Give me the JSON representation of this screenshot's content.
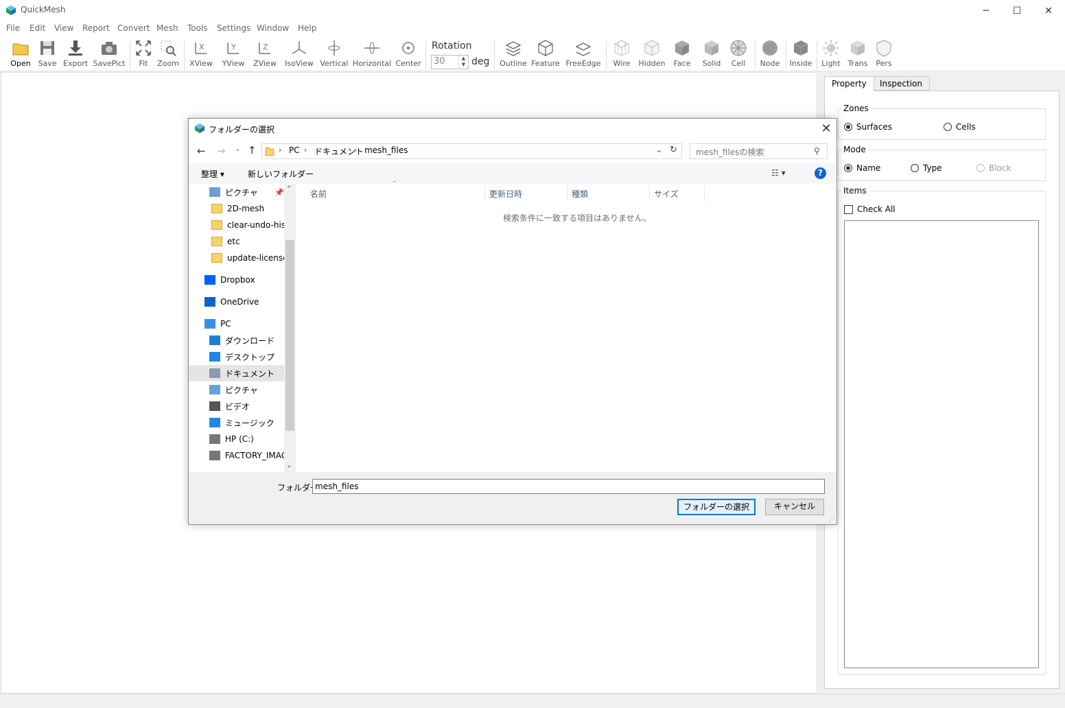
{
  "app": {
    "title": "QuickMesh",
    "accent": "#0078d7"
  },
  "window_controls": {
    "minimize": "─",
    "maximize": "☐",
    "close": "✕"
  },
  "menu": [
    "File",
    "Edit",
    "View",
    "Report",
    "Convert",
    "Mesh",
    "Tools",
    "Settings",
    "Window",
    "Help"
  ],
  "toolbar": {
    "open": "Open",
    "save": "Save",
    "export": "Export",
    "savepict": "SavePict",
    "fit": "Fit",
    "zoom": "Zoom",
    "xview": "XView",
    "yview": "YView",
    "zview": "ZView",
    "isoview": "IsoView",
    "vertical": "Vertical",
    "horizontal": "Horizontal",
    "center": "Center",
    "rotation_label": "Rotation",
    "rotation_value": "30",
    "rotation_unit": "deg",
    "outline": "Outline",
    "feature": "Feature",
    "freeedge": "FreeEdge",
    "wire": "Wire",
    "hidden": "Hidden",
    "face": "Face",
    "solid": "Solid",
    "cell": "Cell",
    "node": "Node",
    "inside": "Inside",
    "light": "Light",
    "trans": "Trans",
    "pers": "Pers"
  },
  "panel": {
    "tabs": [
      "Property",
      "Inspection"
    ],
    "zones": {
      "title": "Zones",
      "options": [
        "Surfaces",
        "Cells"
      ],
      "selected": "Surfaces"
    },
    "mode": {
      "title": "Mode",
      "options": [
        "Name",
        "Type",
        "Block"
      ],
      "selected": "Name",
      "disabled": "Block"
    },
    "items": {
      "title": "Items",
      "check_all": "Check All"
    }
  },
  "dialog": {
    "title": "フォルダーの選択",
    "breadcrumb": [
      "PC",
      "ドキュメント",
      "mesh_files"
    ],
    "search_placeholder": "mesh_filesの検索",
    "organize": "整理 ▾",
    "new_folder": "新しいフォルダー",
    "nav_items": [
      {
        "label": "ピクチャ",
        "icon": "pictures-icon"
      },
      {
        "label": "2D-mesh",
        "icon": "folder-icon"
      },
      {
        "label": "clear-undo-history",
        "icon": "folder-icon"
      },
      {
        "label": "etc",
        "icon": "folder-synced-icon"
      },
      {
        "label": "update-license",
        "icon": "folder-icon"
      },
      {
        "label": "Dropbox",
        "icon": "dropbox-icon"
      },
      {
        "label": "OneDrive",
        "icon": "onedrive-icon"
      },
      {
        "label": "PC",
        "icon": "pc-icon"
      },
      {
        "label": "ダウンロード",
        "icon": "download-icon"
      },
      {
        "label": "デスクトップ",
        "icon": "desktop-icon"
      },
      {
        "label": "ドキュメント",
        "icon": "documents-icon"
      },
      {
        "label": "ピクチャ",
        "icon": "pictures-icon"
      },
      {
        "label": "ビデオ",
        "icon": "video-icon"
      },
      {
        "label": "ミュージック",
        "icon": "music-icon"
      },
      {
        "label": "HP (C:)",
        "icon": "drive-icon"
      },
      {
        "label": "FACTORY_IMAGE",
        "icon": "drive-icon"
      }
    ],
    "selected_nav": "ドキュメント",
    "columns": [
      "名前",
      "更新日時",
      "種類",
      "サイズ"
    ],
    "empty_message": "検索条件に一致する項目はありません。",
    "folder_label": "フォルダー:",
    "folder_value": "mesh_files",
    "select_button": "フォルダーの選択",
    "cancel_button": "キャンセル"
  }
}
